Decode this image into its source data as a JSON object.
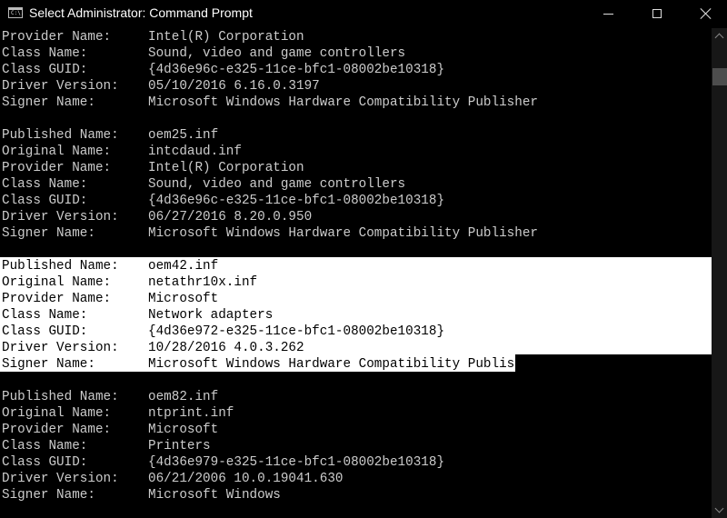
{
  "window": {
    "title": "Select Administrator: Command Prompt",
    "icon": "cmd-icon",
    "icon_text": "C:\\.",
    "controls": {
      "minimize": "minimize-icon",
      "maximize": "maximize-icon",
      "close": "close-icon"
    }
  },
  "colors": {
    "background": "#000000",
    "text": "#cccccc",
    "selection_bg": "#ffffff",
    "selection_text": "#000000",
    "scrollbar_track": "#171717",
    "scrollbar_thumb": "#4d4d4d"
  },
  "console": {
    "lines": [
      {
        "key": "Provider Name:",
        "value": "Intel(R) Corporation"
      },
      {
        "key": "Class Name:",
        "value": "Sound, video and game controllers"
      },
      {
        "key": "Class GUID:",
        "value": "{4d36e96c-e325-11ce-bfc1-08002be10318}"
      },
      {
        "key": "Driver Version:",
        "value": "05/10/2016 6.16.0.3197"
      },
      {
        "key": "Signer Name:",
        "value": "Microsoft Windows Hardware Compatibility Publisher"
      },
      {
        "key": "",
        "value": ""
      },
      {
        "key": "Published Name:",
        "value": "oem25.inf"
      },
      {
        "key": "Original Name:",
        "value": "intcdaud.inf"
      },
      {
        "key": "Provider Name:",
        "value": "Intel(R) Corporation"
      },
      {
        "key": "Class Name:",
        "value": "Sound, video and game controllers"
      },
      {
        "key": "Class GUID:",
        "value": "{4d36e96c-e325-11ce-bfc1-08002be10318}"
      },
      {
        "key": "Driver Version:",
        "value": "06/27/2016 8.20.0.950"
      },
      {
        "key": "Signer Name:",
        "value": "Microsoft Windows Hardware Compatibility Publisher"
      },
      {
        "key": "",
        "value": ""
      },
      {
        "key": "Published Name:",
        "value": "oem42.inf",
        "selected": true
      },
      {
        "key": "Original Name:",
        "value": "netathr10x.inf",
        "selected": true
      },
      {
        "key": "Provider Name:",
        "value": "Microsoft",
        "selected": true
      },
      {
        "key": "Class Name:",
        "value": "Network adapters",
        "selected": true
      },
      {
        "key": "Class GUID:",
        "value": "{4d36e972-e325-11ce-bfc1-08002be10318}",
        "selected": true
      },
      {
        "key": "Driver Version:",
        "value": "10/28/2016 4.0.3.262",
        "selected": true
      },
      {
        "key": "Signer Name:",
        "value": "Microsoft Windows Hardware Compatibility Publisher",
        "selected": true
      },
      {
        "key": "",
        "value": ""
      },
      {
        "key": "Published Name:",
        "value": "oem82.inf"
      },
      {
        "key": "Original Name:",
        "value": "ntprint.inf"
      },
      {
        "key": "Provider Name:",
        "value": "Microsoft"
      },
      {
        "key": "Class Name:",
        "value": "Printers"
      },
      {
        "key": "Class GUID:",
        "value": "{4d36e979-e325-11ce-bfc1-08002be10318}"
      },
      {
        "key": "Driver Version:",
        "value": "06/21/2006 10.0.19041.630"
      },
      {
        "key": "Signer Name:",
        "value": "Microsoft Windows"
      }
    ]
  },
  "scrollbar": {
    "up_icon": "chevron-up-icon",
    "down_icon": "chevron-down-icon"
  }
}
